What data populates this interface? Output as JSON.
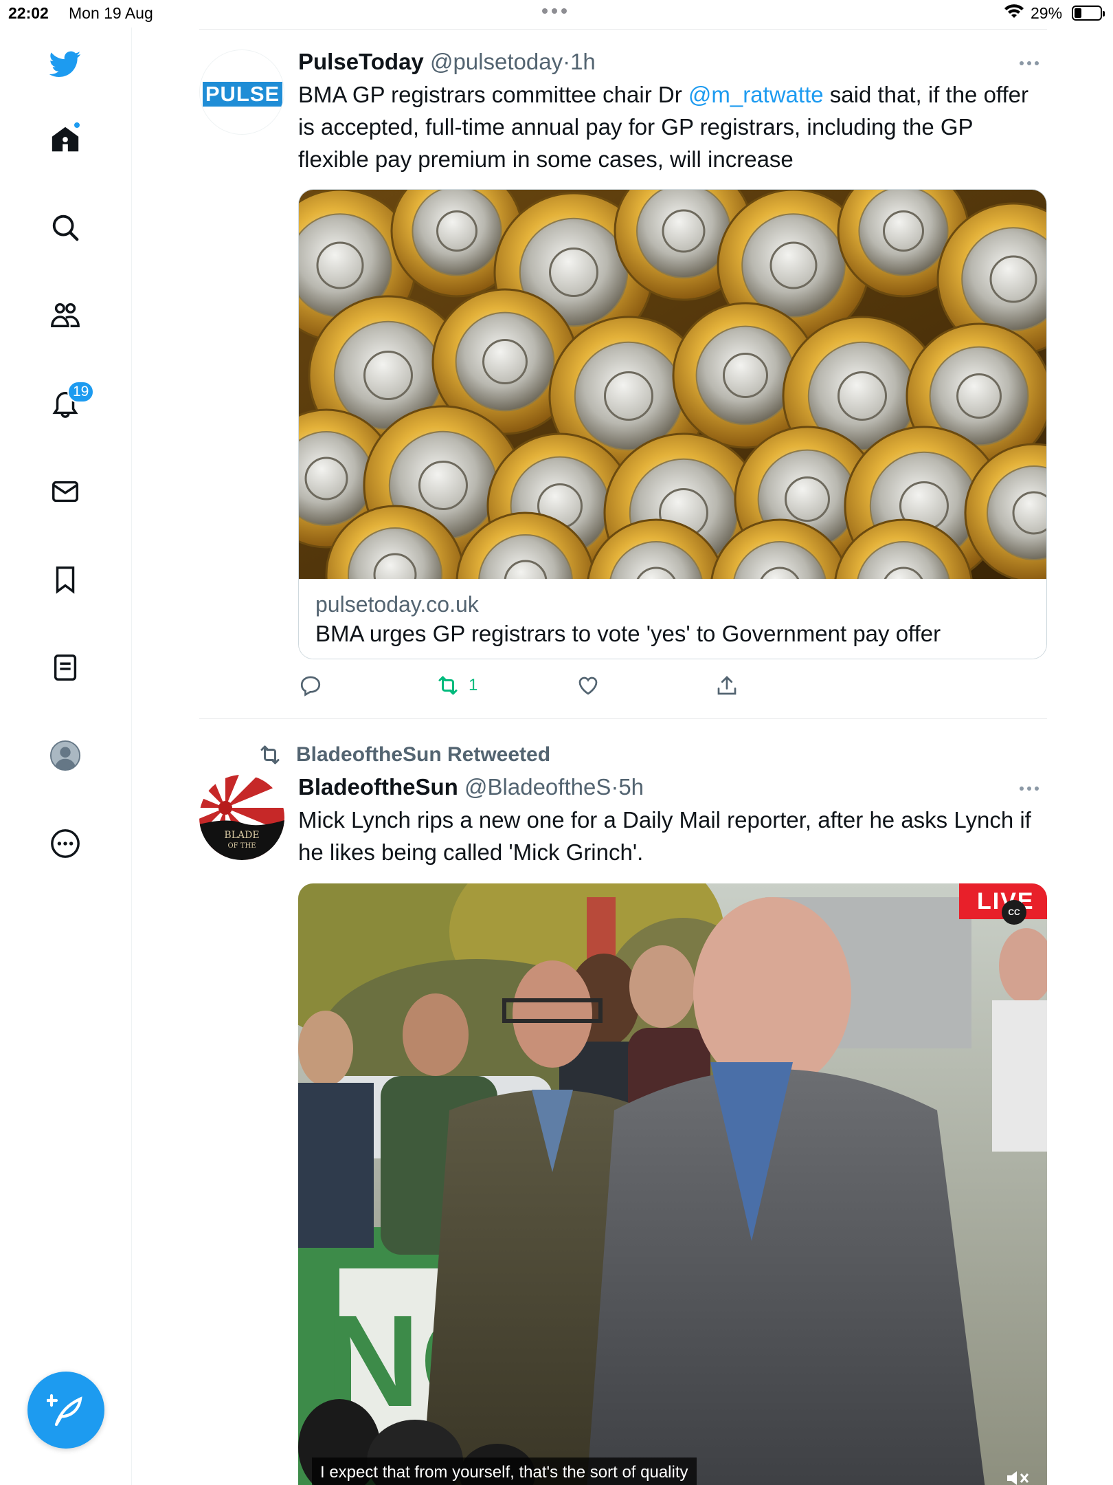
{
  "status_bar": {
    "time": "22:02",
    "date": "Mon 19 Aug",
    "battery": "29%"
  },
  "sidebar": {
    "items": [
      {
        "name": "twitter-bird-icon"
      },
      {
        "name": "home-icon"
      },
      {
        "name": "search-icon"
      },
      {
        "name": "communities-icon"
      },
      {
        "name": "notifications-icon",
        "badge": "19"
      },
      {
        "name": "messages-icon"
      },
      {
        "name": "bookmarks-icon"
      },
      {
        "name": "lists-icon"
      },
      {
        "name": "profile-icon"
      },
      {
        "name": "more-icon"
      }
    ],
    "compose_icon": "compose-tweet-icon",
    "accent": "#1d9bf0"
  },
  "tweets": [
    {
      "avatar_text": "PULSE",
      "name": "PulseToday",
      "handle": "@pulsetoday",
      "separator": "·",
      "time": "1h",
      "text_before": "BMA GP registrars committee chair Dr ",
      "mention": "@m_ratwatte",
      "text_after": " said that, if the offer is accepted, full-time annual pay for GP registrars, including the GP flexible pay premium in some cases, will increase",
      "card": {
        "domain": "pulsetoday.co.uk",
        "title": "BMA urges GP registrars to vote 'yes' to Government pay offer",
        "image": "pound-coins"
      },
      "actions": {
        "retweet_count": "1"
      }
    },
    {
      "retweeted_by": "BladeoftheSun Retweeted",
      "avatar_text": "BLADE OF THE SUN",
      "name": "BladeoftheSun",
      "handle": "@BladeoftheS",
      "separator": "·",
      "time": "5h",
      "text": "Mick Lynch rips a new one for a Daily Mail reporter, after he asks Lynch if he likes being called 'Mick Grinch'.",
      "video": {
        "live_label": "LIVE",
        "cc_label": "CC",
        "caption": "I expect that from yourself, that's the sort of quality"
      }
    }
  ]
}
